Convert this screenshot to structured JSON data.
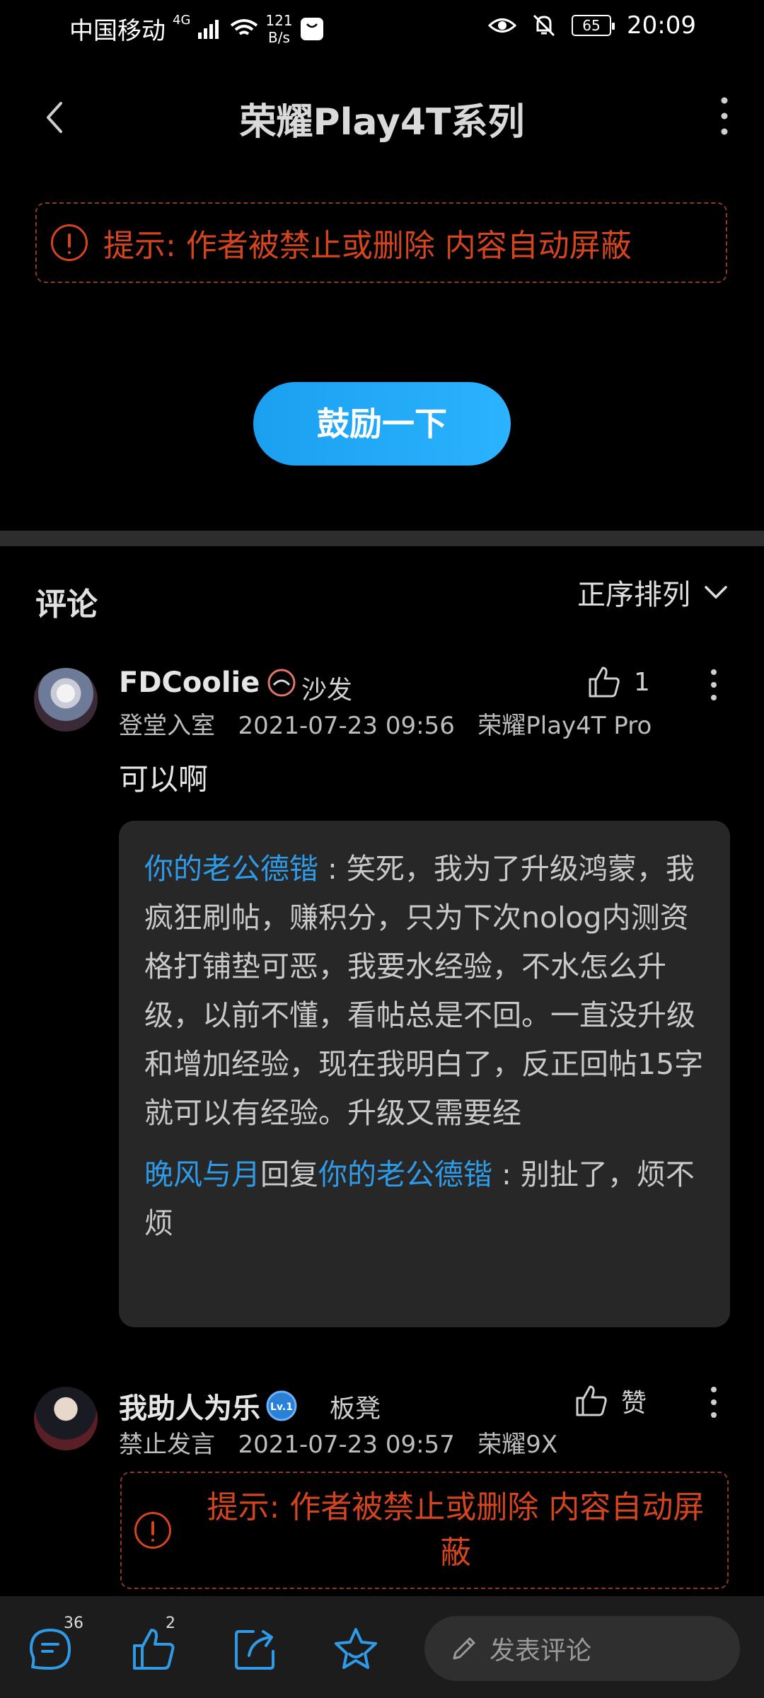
{
  "status_bar": {
    "carrier": "中国移动",
    "network": "4G",
    "speed_value": "121",
    "speed_unit": "B/s",
    "battery": "65",
    "time": "20:09"
  },
  "header": {
    "title": "荣耀Play4T系列"
  },
  "notice": {
    "text": "提示: 作者被禁止或删除 内容自动屏蔽"
  },
  "encourage_button": "鼓励一下",
  "comments_section": {
    "title": "评论",
    "sort_label": "正序排列"
  },
  "comments": [
    {
      "name": "FDCoolie",
      "floor": "沙发",
      "likes": "1",
      "level": "登堂入室",
      "datetime": "2021-07-23 09:56",
      "device": "荣耀Play4T Pro",
      "text": "可以啊",
      "replies": [
        {
          "user": "你的老公德锴",
          "separator": " : ",
          "text": "笑死，我为了升级鸿蒙，我疯狂刷帖，赚积分，只为下次nolog内测资格打铺垫可恶，我要水经验，不水怎么升级，以前不懂，看帖总是不回。一直没升级和增加经验，现在我明白了，反正回帖15字就可以有经验。升级又需要经"
        },
        {
          "user": "晚风与月",
          "reply_word": "回复",
          "target": "你的老公德锴",
          "separator": " : ",
          "text": "别扯了，烦不烦"
        }
      ]
    },
    {
      "name": "我助人为乐",
      "badge": "Lv.1",
      "floor": "板凳",
      "likes": "赞",
      "level": "禁止发言",
      "datetime": "2021-07-23 09:57",
      "device": "荣耀9X",
      "notice_line1": "提示: 作者被禁止或删除 内容自动屏",
      "notice_line2": "蔽"
    }
  ],
  "bottom_bar": {
    "comment_count": "36",
    "like_count": "2",
    "input_placeholder": "发表评论"
  },
  "colors": {
    "accent": "#2f9ae6",
    "warning": "#d4451f",
    "button": "#22aaf5"
  }
}
